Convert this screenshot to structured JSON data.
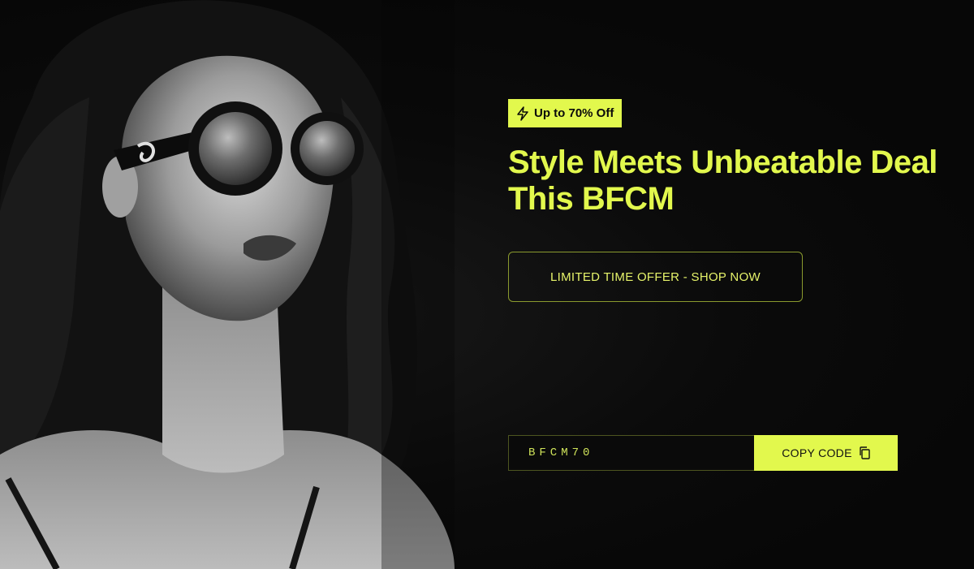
{
  "colors": {
    "accent": "#e2f84d",
    "background": "#070707"
  },
  "hero": {
    "badge": {
      "icon": "lightning-icon",
      "label": "Up to 70% Off"
    },
    "headline": {
      "line1": "Style Meets Unbeatable Deal",
      "line2": "This BFCM"
    },
    "cta_label": "LIMITED TIME OFFER - SHOP NOW",
    "coupon": {
      "code": "BFCM70",
      "button_label": "COPY CODE",
      "button_icon": "copy-icon"
    }
  },
  "image": {
    "subject": "woman-with-round-sunglasses-photo"
  }
}
